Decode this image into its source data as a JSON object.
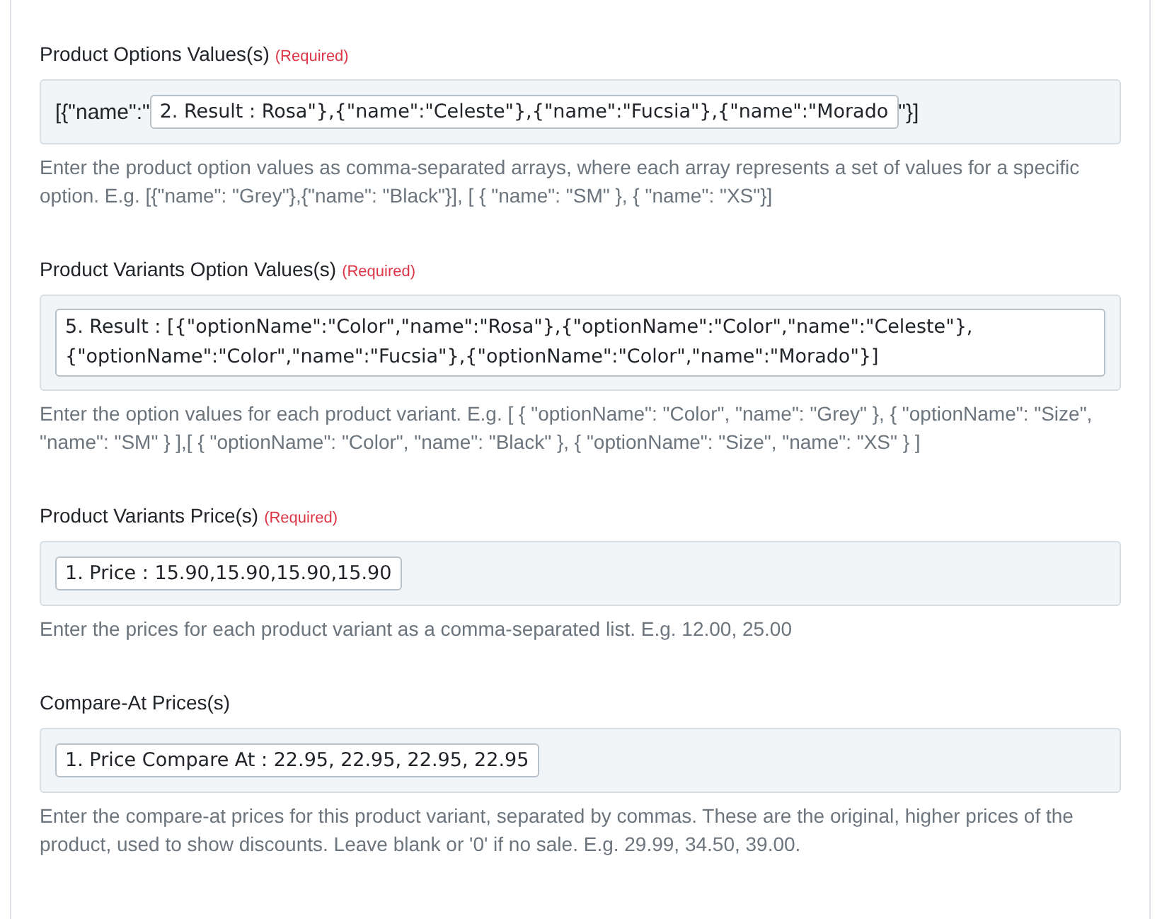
{
  "fields": [
    {
      "label": "Product Options Values(s)",
      "required_label": "(Required)",
      "parts": [
        {
          "kind": "text",
          "text": "[{\"name\":\""
        },
        {
          "kind": "token",
          "text": "2. Result : Rosa\"},{\"name\":\"Celeste\"},{\"name\":\"Fucsia\"},{\"name\":\"Morado"
        },
        {
          "kind": "text",
          "text": "\"}]"
        }
      ],
      "help": "Enter the product option values as comma-separated arrays, where each array represents a set of values for a specific option. E.g. [{\"name\": \"Grey\"},{\"name\": \"Black\"}], [ { \"name\": \"SM\" }, { \"name\": \"XS\"}]"
    },
    {
      "label": "Product Variants Option Values(s)",
      "required_label": "(Required)",
      "parts": [
        {
          "kind": "block",
          "text": "5. Result : [{\"optionName\":\"Color\",\"name\":\"Rosa\"},{\"optionName\":\"Color\",\"name\":\"Celeste\"}, {\"optionName\":\"Color\",\"name\":\"Fucsia\"},{\"optionName\":\"Color\",\"name\":\"Morado\"}]"
        }
      ],
      "help": "Enter the option values for each product variant. E.g. [ { \"optionName\": \"Color\", \"name\": \"Grey\" }, { \"optionName\": \"Size\", \"name\": \"SM\" } ],[ { \"optionName\": \"Color\", \"name\": \"Black\" }, { \"optionName\": \"Size\", \"name\": \"XS\" } ]"
    },
    {
      "label": "Product Variants Price(s)",
      "required_label": "(Required)",
      "parts": [
        {
          "kind": "token",
          "text": "1. Price : 15.90,15.90,15.90,15.90"
        }
      ],
      "help": "Enter the prices for each product variant as a comma-separated list. E.g. 12.00, 25.00"
    },
    {
      "label": "Compare-At Prices(s)",
      "parts": [
        {
          "kind": "token",
          "text": "1. Price Compare At : 22.95, 22.95, 22.95, 22.95"
        }
      ],
      "help": "Enter the compare-at prices for this product variant, separated by commas. These are the original, higher prices of the product, used to show discounts. Leave blank or '0' if no sale. E.g. 29.99, 34.50, 39.00."
    }
  ]
}
